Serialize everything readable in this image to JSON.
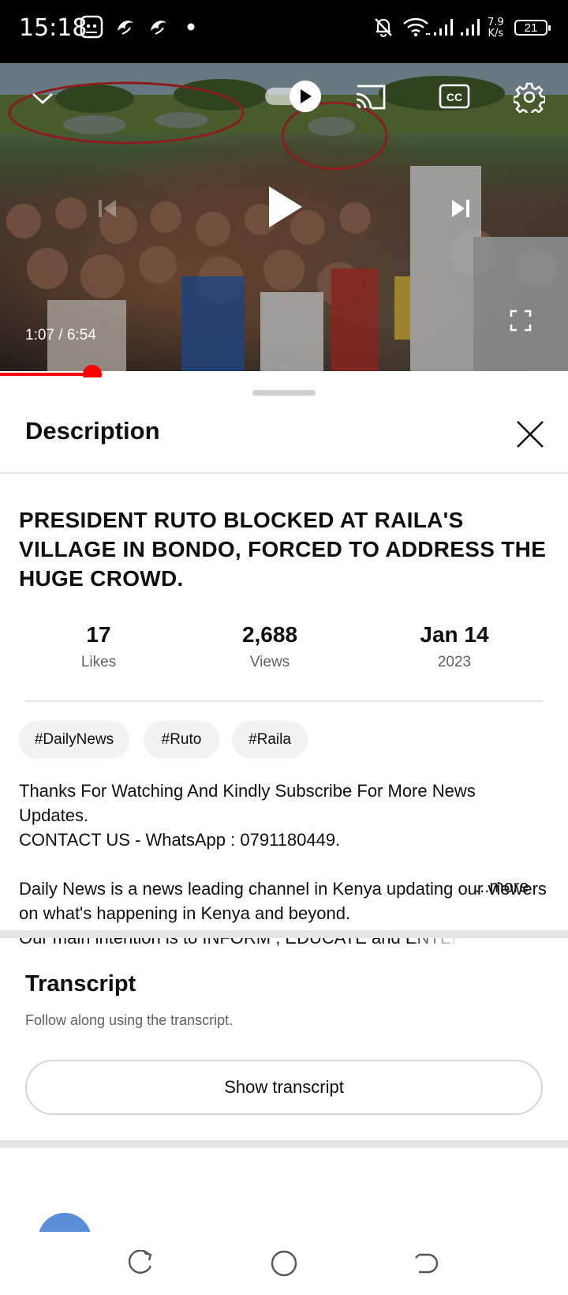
{
  "status_bar": {
    "time": "15:18",
    "net_speed_value": "7.9",
    "net_speed_unit": "K/s",
    "battery": "21"
  },
  "player": {
    "time_current": "1:07",
    "time_total": "6:54",
    "time_separator": " / ",
    "progress_fraction": 0.162,
    "accent_color": "#ff0000"
  },
  "sheet": {
    "title": "Description"
  },
  "video": {
    "title": "PRESIDENT RUTO BLOCKED AT RAILA'S VILLAGE IN BONDO, FORCED TO ADDRESS THE HUGE CROWD.",
    "stats": [
      {
        "value": "17",
        "label": "Likes"
      },
      {
        "value": "2,688",
        "label": "Views"
      },
      {
        "value": "Jan 14",
        "label": "2023"
      }
    ],
    "tags": [
      "#DailyNews",
      "#Ruto",
      "#Raila"
    ],
    "description_lines": [
      "Thanks For Watching And Kindly Subscribe For More News Updates.",
      "CONTACT US - WhatsApp : 0791180449.",
      "Daily News is a news leading channel in Kenya updating our viewers on what's happening in Kenya and beyond.",
      "Our main intention is to INFORM , EDUCATE and ENTERTAIN"
    ],
    "more_label": "...more"
  },
  "transcript": {
    "title": "Transcript",
    "subtitle": "Follow along using the transcript.",
    "button_label": "Show transcript"
  },
  "icons": [
    "chevron-down-icon",
    "autoplay-toggle",
    "cast-icon",
    "cc-icon",
    "gear-icon",
    "previous-icon",
    "play-icon",
    "next-icon",
    "fullscreen-icon",
    "close-icon",
    "recents-icon",
    "home-icon",
    "back-icon"
  ]
}
